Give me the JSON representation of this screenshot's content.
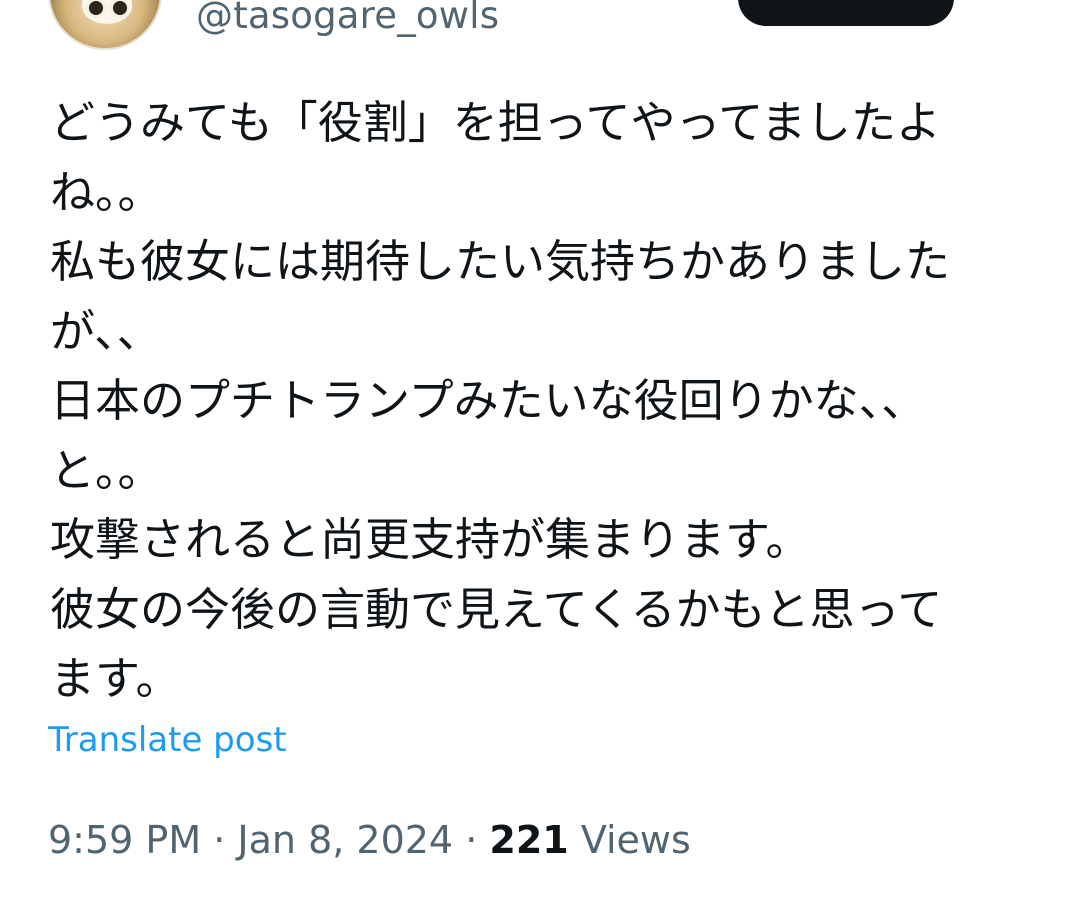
{
  "author": {
    "handle": "@tasogare_owls"
  },
  "tweet": {
    "lines": [
      "どうみても「役割」を担ってやってましたよ",
      "ね。。",
      "私も彼女には期待したい気持ちかありました",
      "が、、",
      "日本のプチトランプみたいな役回りかな、、",
      "と。。",
      "攻撃されると尚更支持が集まります。",
      "彼女の今後の言動で見えてくるかもと思って",
      "ます。"
    ],
    "translate_label": "Translate post"
  },
  "meta": {
    "time": "9:59 PM",
    "separator": "·",
    "date": "Jan 8, 2024",
    "views_count": "221",
    "views_label": "Views"
  },
  "colors": {
    "text": "#0f1419",
    "secondary": "#536471",
    "link": "#1d9bf0",
    "button": "#0f1419"
  },
  "icons": {
    "avatar": "owl-avatar"
  }
}
